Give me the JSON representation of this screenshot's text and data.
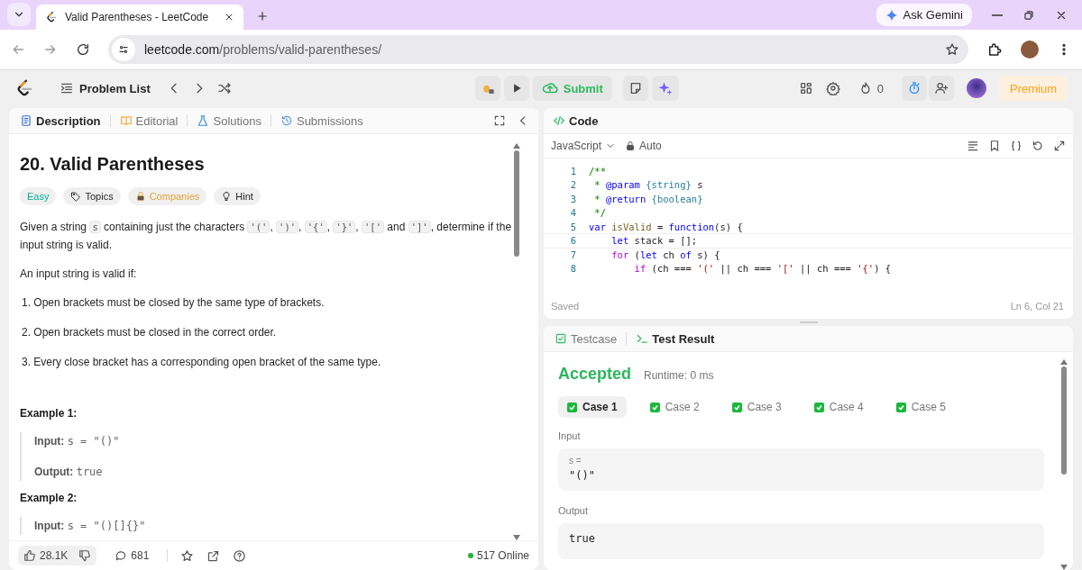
{
  "browser": {
    "tab_title": "Valid Parentheses - LeetCode",
    "url_host": "leetcode.com",
    "url_path": "/problems/valid-parentheses/",
    "ask": "Ask Gemini"
  },
  "toolbar": {
    "problem_list": "Problem List",
    "submit": "Submit",
    "streak": "0",
    "premium": "Premium"
  },
  "left_tabs": [
    {
      "label": "Description",
      "selected": true,
      "kind": "doc"
    },
    {
      "label": "Editorial",
      "selected": false,
      "kind": "book"
    },
    {
      "label": "Solutions",
      "selected": false,
      "kind": "flask"
    },
    {
      "label": "Submissions",
      "selected": false,
      "kind": "history"
    }
  ],
  "problem": {
    "title": "20. Valid Parentheses",
    "tags": [
      {
        "label": "Easy",
        "kind": "difficulty"
      },
      {
        "label": "Topics",
        "kind": "topics"
      },
      {
        "label": "Companies",
        "kind": "companies"
      },
      {
        "label": "Hint",
        "kind": "hint"
      }
    ],
    "intro": [
      {
        "text": "Given a string ",
        "code": false
      },
      {
        "text": "s",
        "code": true
      },
      {
        "text": " containing just the characters ",
        "code": false
      },
      {
        "text": "'('",
        "code": true
      },
      {
        "text": ", ",
        "code": false
      },
      {
        "text": "')'",
        "code": true
      },
      {
        "text": ", ",
        "code": false
      },
      {
        "text": "'{'",
        "code": true
      },
      {
        "text": ", ",
        "code": false
      },
      {
        "text": "'}'",
        "code": true
      },
      {
        "text": ", ",
        "code": false
      },
      {
        "text": "'['",
        "code": true
      },
      {
        "text": " and ",
        "code": false
      },
      {
        "text": "']'",
        "code": true
      },
      {
        "text": ", determine if the input string is valid.",
        "code": false
      }
    ],
    "lead": "An input string is valid if:",
    "rules": [
      "1. Open brackets must be closed by the same type of brackets.",
      "2. Open brackets must be closed in the correct order.",
      "3. Every close bracket has a corresponding open bracket of the same type."
    ],
    "examples": [
      {
        "title": "Example 1:",
        "lines": [
          {
            "label": "Input:",
            "value": "s = \"()\""
          },
          {
            "label": "Output:",
            "value": "true"
          }
        ]
      },
      {
        "title": "Example 2:",
        "lines": [
          {
            "label": "Input:",
            "value": "s = \"()[]{}\""
          }
        ]
      }
    ]
  },
  "footer": {
    "likes": "28.1K",
    "comments": "681",
    "online": "517 Online"
  },
  "editor": {
    "title": "Code",
    "language": "JavaScript",
    "mode": "Auto",
    "lines": [
      {
        "number": "1",
        "current": false,
        "text": "/**"
      },
      {
        "number": "2",
        "current": false,
        "text": " * @param {string} s"
      },
      {
        "number": "3",
        "current": false,
        "text": " * @return {boolean}"
      },
      {
        "number": "4",
        "current": false,
        "text": " */"
      },
      {
        "number": "5",
        "current": false,
        "text": "var isValid = function(s) {"
      },
      {
        "number": "6",
        "current": true,
        "text": "    let stack = [];"
      },
      {
        "number": "7",
        "current": false,
        "text": "    for (let ch of s) {"
      },
      {
        "number": "8",
        "current": false,
        "text": "        if (ch === '(' || ch === '[' || ch === '{') {"
      }
    ],
    "saved": "Saved",
    "cursor": "Ln 6, Col 21"
  },
  "bottom_tabs": [
    {
      "label": "Testcase",
      "selected": false,
      "kind": "check"
    },
    {
      "label": "Test Result",
      "selected": true,
      "kind": "terminal"
    }
  ],
  "result": {
    "verdict": "Accepted",
    "runtime": "Runtime: 0 ms",
    "cases": [
      {
        "label": "Case 1",
        "selected": true,
        "passed": true
      },
      {
        "label": "Case 2",
        "selected": false,
        "passed": true
      },
      {
        "label": "Case 3",
        "selected": false,
        "passed": true
      },
      {
        "label": "Case 4",
        "selected": false,
        "passed": true
      },
      {
        "label": "Case 5",
        "selected": false,
        "passed": true
      }
    ],
    "input_label": "Input",
    "input_var": "s =",
    "input_value": "\"()\"",
    "output_label": "Output",
    "output_value": "true"
  }
}
